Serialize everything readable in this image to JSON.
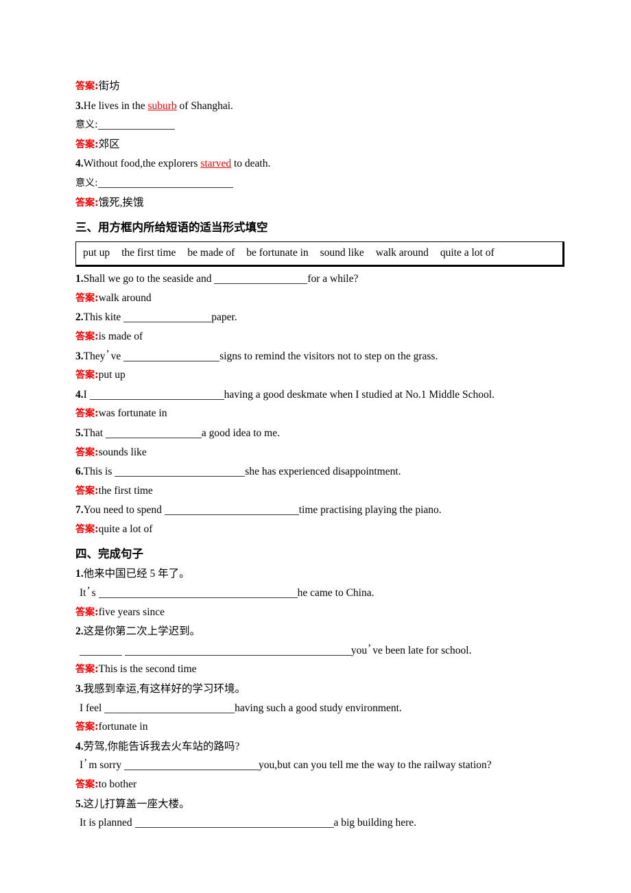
{
  "document": {
    "type": "english-exercise-worksheet",
    "answer_label": "答案",
    "colon": ":",
    "meaning_label": "意义",
    "apostrophe": "ʼ"
  },
  "top_block": {
    "answer_1": {
      "label": "答案",
      "colon": ":",
      "text": "街坊"
    },
    "item_3": {
      "num": "3.",
      "before": "He lives in the ",
      "keyword": "suburb",
      "after": " of Shanghai."
    },
    "meaning_3": {
      "label": "意义",
      "colon": ":",
      "blank_width": 112
    },
    "answer_3": {
      "label": "答案",
      "colon": ":",
      "text": "郊区"
    },
    "item_4": {
      "num": "4.",
      "before": "Without food,the explorers ",
      "keyword": "starved",
      "after": " to death."
    },
    "meaning_4": {
      "label": "意义",
      "colon": ":",
      "blank_width": 197
    },
    "answer_4": {
      "label": "答案",
      "colon": ":",
      "text": "饿死,挨饿"
    }
  },
  "section_three": {
    "heading": "三、用方框内所给短语的适当形式填空",
    "word_bank": [
      "put up",
      "the first time",
      "be made of",
      "be fortunate in",
      "sound like",
      "walk around",
      "quite a lot of"
    ],
    "questions": [
      {
        "num": "1.",
        "before": "Shall we go to the seaside and ",
        "blank_width": 136,
        "after": "for a while?",
        "answer_label": "答案",
        "answer_text": "walk around"
      },
      {
        "num": "2.",
        "before": "This kite ",
        "blank_width": 128,
        "after": "paper.",
        "answer_label": "答案",
        "answer_text": "is made of"
      },
      {
        "num": "3.",
        "before": "Theyʼve ",
        "blank_width": 140,
        "after": "signs to remind the visitors not to step on the grass.",
        "answer_label": "答案",
        "answer_text": "put up"
      },
      {
        "num": "4.",
        "before": "I ",
        "blank_width": 196,
        "after": "having a good deskmate when I studied at No.1 Middle School.",
        "answer_label": "答案",
        "answer_text": "was fortunate in"
      },
      {
        "num": "5.",
        "before": "That ",
        "blank_width": 140,
        "after": "a good idea to me.",
        "answer_label": "答案",
        "answer_text": "sounds like"
      },
      {
        "num": "6.",
        "before": "This is ",
        "blank_width": 190,
        "after": "she has experienced disappointment.",
        "answer_label": "答案",
        "answer_text": "the first time"
      },
      {
        "num": "7.",
        "before": "You need to spend ",
        "blank_width": 196,
        "after": "time practising playing the piano.",
        "answer_label": "答案",
        "answer_text": "quite a lot of"
      }
    ]
  },
  "section_four": {
    "heading": "四、完成句子",
    "questions": [
      {
        "num": "1.",
        "chinese": "他来中国已经 5 年了。",
        "english_before": "Itʼs ",
        "blank_width": 290,
        "english_after": "he came to China.",
        "answer_label": "答案",
        "answer_text": "five years since"
      },
      {
        "num": "2.",
        "chinese": "这是你第二次上学迟到。",
        "english_before": "",
        "lead_blank_width": 62,
        "blank_width": 330,
        "english_after": "youʼve been late for school.",
        "answer_label": "答案",
        "answer_text": "This is the second time"
      },
      {
        "num": "3.",
        "chinese": "我感到幸运,有这样好的学习环境。",
        "english_before": "I feel ",
        "blank_width": 190,
        "english_after": "having such a good study environment.",
        "answer_label": "答案",
        "answer_text": "fortunate in"
      },
      {
        "num": "4.",
        "chinese": "劳驾,你能告诉我去火车站的路吗?",
        "english_before": "Iʼm sorry ",
        "blank_width": 196,
        "english_after": "you,but can you tell me the way to the railway station?",
        "answer_label": "答案",
        "answer_text": "to bother"
      },
      {
        "num": "5.",
        "chinese": "这儿打算盖一座大楼。",
        "english_before": "It is planned ",
        "blank_width": 290,
        "english_after": "a big building here.",
        "answer_label": "答案",
        "answer_text": ""
      }
    ]
  },
  "colors": {
    "answer_red": "#ee0000",
    "text_black": "#000000",
    "blank_rule": "#333333",
    "page_background": "#ffffff"
  }
}
